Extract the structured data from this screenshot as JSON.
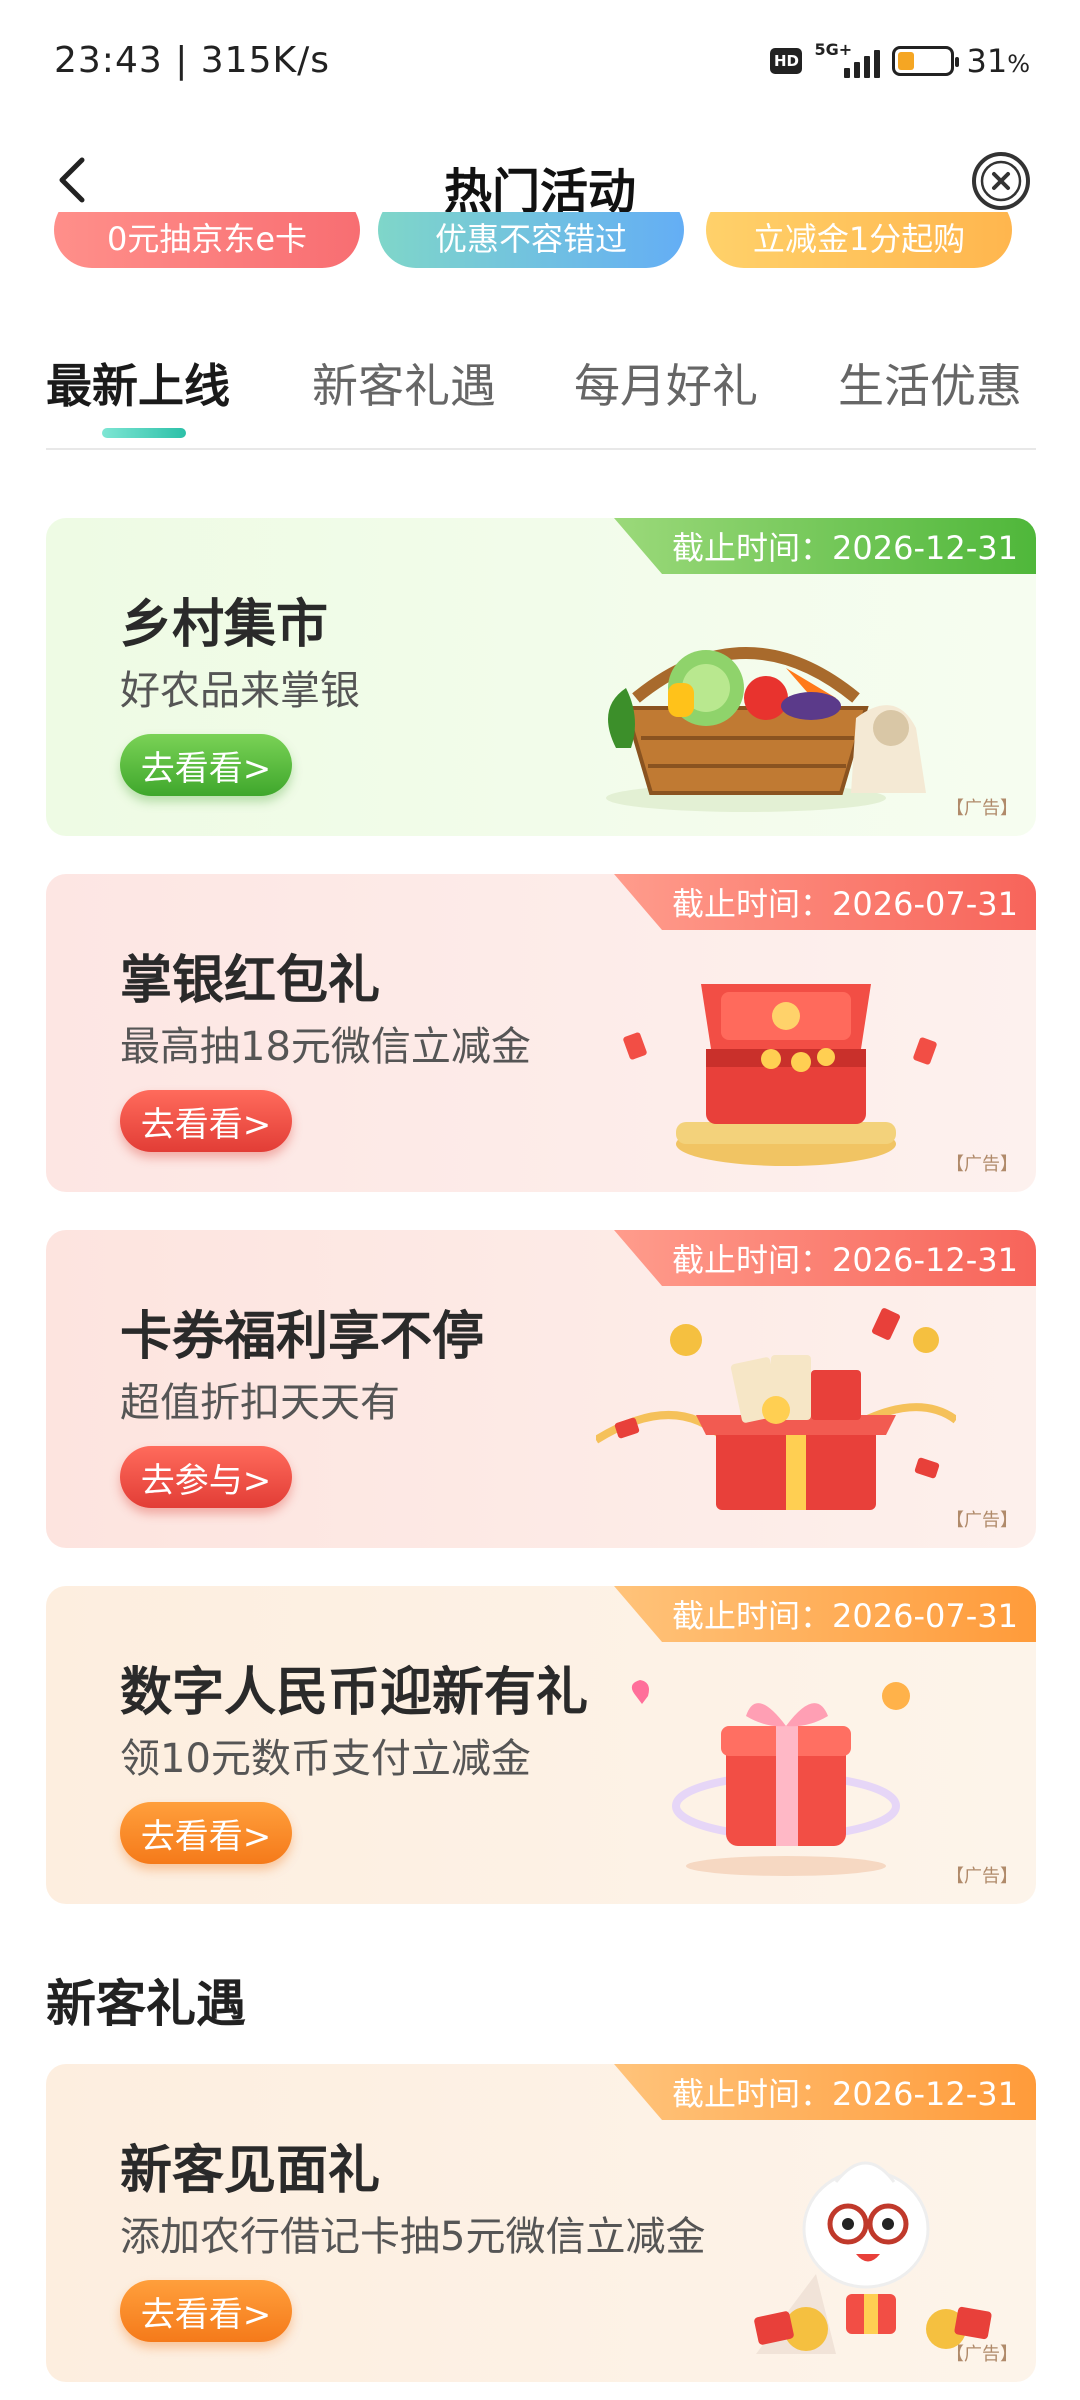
{
  "status_bar": {
    "time": "23:43",
    "speed": "315K/s",
    "hd": "HD",
    "network": "5G+",
    "battery_percent": "31",
    "battery_unit": "%",
    "battery_level": 0.31
  },
  "nav": {
    "title": "热门活动",
    "back_icon": "chevron-left-icon",
    "close_icon": "close-circle-icon"
  },
  "banner_strip": [
    {
      "label": "0元抽京东e卡"
    },
    {
      "label": "优惠不容错过"
    },
    {
      "label": "立减金1分起购"
    }
  ],
  "tabs": [
    {
      "label": "最新上线",
      "active": true
    },
    {
      "label": "新客礼遇",
      "active": false
    },
    {
      "label": "每月好礼",
      "active": false
    },
    {
      "label": "生活优惠",
      "active": false
    }
  ],
  "cards": [
    {
      "deadline": "截止时间：2026-12-31",
      "title": "乡村集市",
      "subtitle": "好农品来掌银",
      "button": "去看看>",
      "ad": "【广告】",
      "art_icon": "vegetable-basket-icon",
      "accent": "#4fb73a"
    },
    {
      "deadline": "截止时间：2026-07-31",
      "title": "掌银红包礼",
      "subtitle": "最高抽18元微信立减金",
      "button": "去看看>",
      "ad": "【广告】",
      "art_icon": "red-gift-box-icon",
      "accent": "#e23d36"
    },
    {
      "deadline": "截止时间：2026-12-31",
      "title": "卡券福利享不停",
      "subtitle": "超值折扣天天有",
      "button": "去参与>",
      "ad": "【广告】",
      "art_icon": "open-gift-box-icon",
      "accent": "#e23d36"
    },
    {
      "deadline": "截止时间：2026-07-31",
      "title": "数字人民币迎新有礼",
      "subtitle": "领10元数币支付立减金",
      "button": "去看看>",
      "ad": "【广告】",
      "art_icon": "gift-box-icon",
      "accent": "#f57a1a"
    }
  ],
  "section": {
    "heading": "新客礼遇"
  },
  "new_customer_card": {
    "deadline": "截止时间：2026-12-31",
    "title": "新客见面礼",
    "subtitle": "添加农行借记卡抽5元微信立减金",
    "button": "去看看>",
    "ad": "【广告】",
    "art_icon": "mascot-with-coins-icon",
    "accent": "#f57a1a"
  }
}
